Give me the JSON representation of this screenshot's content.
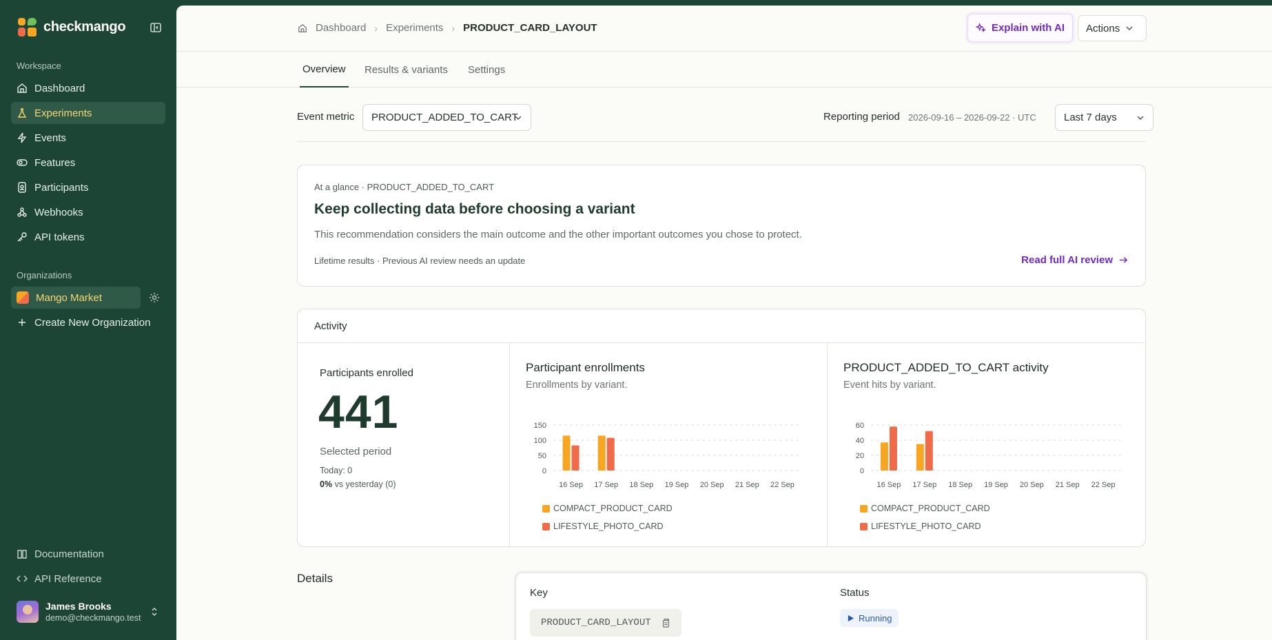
{
  "app": {
    "name": "checkmango",
    "brand_colors": {
      "orange": "#f6a623",
      "red": "#ef6b4a",
      "green": "#6fbf5a",
      "sidebar_bg": "#1d4535",
      "accent_purple": "#6f2bbf"
    }
  },
  "sidebar": {
    "workspace_label": "Workspace",
    "items": [
      {
        "label": "Dashboard",
        "icon": "home-icon",
        "active": false
      },
      {
        "label": "Experiments",
        "icon": "flask-icon",
        "active": true
      },
      {
        "label": "Events",
        "icon": "bolt-icon",
        "active": false
      },
      {
        "label": "Features",
        "icon": "toggle-icon",
        "active": false
      },
      {
        "label": "Participants",
        "icon": "id-badge-icon",
        "active": false
      },
      {
        "label": "Webhooks",
        "icon": "webhook-icon",
        "active": false
      },
      {
        "label": "API tokens",
        "icon": "key-icon",
        "active": false
      }
    ],
    "organizations_label": "Organizations",
    "org": {
      "name": "Mango Market"
    },
    "create_org_label": "Create New Organization",
    "footer_links": [
      {
        "label": "Documentation",
        "icon": "book-icon"
      },
      {
        "label": "API Reference",
        "icon": "code-icon"
      }
    ],
    "user": {
      "name": "James Brooks",
      "email": "demo@checkmango.test"
    }
  },
  "header": {
    "breadcrumb": [
      "Dashboard",
      "Experiments",
      "PRODUCT_CARD_LAYOUT"
    ],
    "explain_label": "Explain with AI",
    "actions_label": "Actions"
  },
  "tabs": [
    {
      "label": "Overview",
      "active": true
    },
    {
      "label": "Results & variants",
      "active": false
    },
    {
      "label": "Settings",
      "active": false
    }
  ],
  "filters": {
    "event_metric_label": "Event metric",
    "event_metric_value": "PRODUCT_ADDED_TO_CART",
    "reporting_label": "Reporting period",
    "reporting_range": "2026-09-16 – 2026-09-22 · UTC",
    "period_value": "Last 7 days"
  },
  "glance": {
    "eyebrow": "At a glance · PRODUCT_ADDED_TO_CART",
    "title": "Keep collecting data before choosing a variant",
    "description": "This recommendation considers the main outcome and the other important outcomes you chose to protect.",
    "footer": "Lifetime results · Previous AI review needs an update",
    "link_label": "Read full AI review"
  },
  "activity": {
    "title": "Activity",
    "participants_label": "Participants enrolled",
    "participants_value": "441",
    "participants_sub": "Selected period",
    "today_text": "Today: 0",
    "change_pct": "0%",
    "change_text": "vs yesterday (0)"
  },
  "chart_data": [
    {
      "type": "bar",
      "title": "Participant enrollments",
      "subtitle": "Enrollments by variant.",
      "categories": [
        "16 Sep",
        "17 Sep",
        "18 Sep",
        "19 Sep",
        "20 Sep",
        "21 Sep",
        "22 Sep"
      ],
      "series": [
        {
          "name": "COMPACT_PRODUCT_CARD",
          "color": "#f6a623",
          "values": [
            115,
            115,
            0,
            0,
            0,
            0,
            0
          ]
        },
        {
          "name": "LIFESTYLE_PHOTO_CARD",
          "color": "#ef6b4a",
          "values": [
            83,
            108,
            0,
            0,
            0,
            0,
            0
          ]
        }
      ],
      "yticks": [
        0,
        50,
        100,
        150
      ],
      "ylim": [
        0,
        150
      ],
      "grid": true,
      "legend": "bottom-left"
    },
    {
      "type": "bar",
      "title": "PRODUCT_ADDED_TO_CART activity",
      "subtitle": "Event hits by variant.",
      "categories": [
        "16 Sep",
        "17 Sep",
        "18 Sep",
        "19 Sep",
        "20 Sep",
        "21 Sep",
        "22 Sep"
      ],
      "series": [
        {
          "name": "COMPACT_PRODUCT_CARD",
          "color": "#f6a623",
          "values": [
            37,
            35,
            0,
            0,
            0,
            0,
            0
          ]
        },
        {
          "name": "LIFESTYLE_PHOTO_CARD",
          "color": "#ef6b4a",
          "values": [
            58,
            52,
            0,
            0,
            0,
            0,
            0
          ]
        }
      ],
      "yticks": [
        0,
        20,
        40,
        60
      ],
      "ylim": [
        0,
        60
      ],
      "grid": true,
      "legend": "bottom-left"
    }
  ],
  "details": {
    "title": "Details",
    "key_label": "Key",
    "key_value": "PRODUCT_CARD_LAYOUT",
    "status_label": "Status",
    "status_value": "Running"
  }
}
